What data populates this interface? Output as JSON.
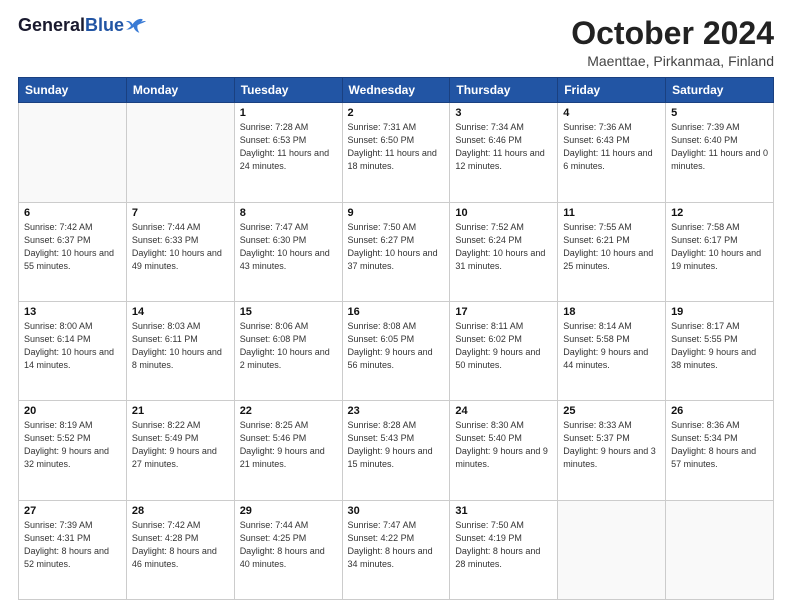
{
  "header": {
    "logo_general": "General",
    "logo_blue": "Blue",
    "month_title": "October 2024",
    "location": "Maenttae, Pirkanmaa, Finland"
  },
  "weekdays": [
    "Sunday",
    "Monday",
    "Tuesday",
    "Wednesday",
    "Thursday",
    "Friday",
    "Saturday"
  ],
  "weeks": [
    [
      {
        "day": "",
        "empty": true
      },
      {
        "day": "",
        "empty": true
      },
      {
        "day": "1",
        "sunrise": "Sunrise: 7:28 AM",
        "sunset": "Sunset: 6:53 PM",
        "daylight": "Daylight: 11 hours and 24 minutes."
      },
      {
        "day": "2",
        "sunrise": "Sunrise: 7:31 AM",
        "sunset": "Sunset: 6:50 PM",
        "daylight": "Daylight: 11 hours and 18 minutes."
      },
      {
        "day": "3",
        "sunrise": "Sunrise: 7:34 AM",
        "sunset": "Sunset: 6:46 PM",
        "daylight": "Daylight: 11 hours and 12 minutes."
      },
      {
        "day": "4",
        "sunrise": "Sunrise: 7:36 AM",
        "sunset": "Sunset: 6:43 PM",
        "daylight": "Daylight: 11 hours and 6 minutes."
      },
      {
        "day": "5",
        "sunrise": "Sunrise: 7:39 AM",
        "sunset": "Sunset: 6:40 PM",
        "daylight": "Daylight: 11 hours and 0 minutes."
      }
    ],
    [
      {
        "day": "6",
        "sunrise": "Sunrise: 7:42 AM",
        "sunset": "Sunset: 6:37 PM",
        "daylight": "Daylight: 10 hours and 55 minutes."
      },
      {
        "day": "7",
        "sunrise": "Sunrise: 7:44 AM",
        "sunset": "Sunset: 6:33 PM",
        "daylight": "Daylight: 10 hours and 49 minutes."
      },
      {
        "day": "8",
        "sunrise": "Sunrise: 7:47 AM",
        "sunset": "Sunset: 6:30 PM",
        "daylight": "Daylight: 10 hours and 43 minutes."
      },
      {
        "day": "9",
        "sunrise": "Sunrise: 7:50 AM",
        "sunset": "Sunset: 6:27 PM",
        "daylight": "Daylight: 10 hours and 37 minutes."
      },
      {
        "day": "10",
        "sunrise": "Sunrise: 7:52 AM",
        "sunset": "Sunset: 6:24 PM",
        "daylight": "Daylight: 10 hours and 31 minutes."
      },
      {
        "day": "11",
        "sunrise": "Sunrise: 7:55 AM",
        "sunset": "Sunset: 6:21 PM",
        "daylight": "Daylight: 10 hours and 25 minutes."
      },
      {
        "day": "12",
        "sunrise": "Sunrise: 7:58 AM",
        "sunset": "Sunset: 6:17 PM",
        "daylight": "Daylight: 10 hours and 19 minutes."
      }
    ],
    [
      {
        "day": "13",
        "sunrise": "Sunrise: 8:00 AM",
        "sunset": "Sunset: 6:14 PM",
        "daylight": "Daylight: 10 hours and 14 minutes."
      },
      {
        "day": "14",
        "sunrise": "Sunrise: 8:03 AM",
        "sunset": "Sunset: 6:11 PM",
        "daylight": "Daylight: 10 hours and 8 minutes."
      },
      {
        "day": "15",
        "sunrise": "Sunrise: 8:06 AM",
        "sunset": "Sunset: 6:08 PM",
        "daylight": "Daylight: 10 hours and 2 minutes."
      },
      {
        "day": "16",
        "sunrise": "Sunrise: 8:08 AM",
        "sunset": "Sunset: 6:05 PM",
        "daylight": "Daylight: 9 hours and 56 minutes."
      },
      {
        "day": "17",
        "sunrise": "Sunrise: 8:11 AM",
        "sunset": "Sunset: 6:02 PM",
        "daylight": "Daylight: 9 hours and 50 minutes."
      },
      {
        "day": "18",
        "sunrise": "Sunrise: 8:14 AM",
        "sunset": "Sunset: 5:58 PM",
        "daylight": "Daylight: 9 hours and 44 minutes."
      },
      {
        "day": "19",
        "sunrise": "Sunrise: 8:17 AM",
        "sunset": "Sunset: 5:55 PM",
        "daylight": "Daylight: 9 hours and 38 minutes."
      }
    ],
    [
      {
        "day": "20",
        "sunrise": "Sunrise: 8:19 AM",
        "sunset": "Sunset: 5:52 PM",
        "daylight": "Daylight: 9 hours and 32 minutes."
      },
      {
        "day": "21",
        "sunrise": "Sunrise: 8:22 AM",
        "sunset": "Sunset: 5:49 PM",
        "daylight": "Daylight: 9 hours and 27 minutes."
      },
      {
        "day": "22",
        "sunrise": "Sunrise: 8:25 AM",
        "sunset": "Sunset: 5:46 PM",
        "daylight": "Daylight: 9 hours and 21 minutes."
      },
      {
        "day": "23",
        "sunrise": "Sunrise: 8:28 AM",
        "sunset": "Sunset: 5:43 PM",
        "daylight": "Daylight: 9 hours and 15 minutes."
      },
      {
        "day": "24",
        "sunrise": "Sunrise: 8:30 AM",
        "sunset": "Sunset: 5:40 PM",
        "daylight": "Daylight: 9 hours and 9 minutes."
      },
      {
        "day": "25",
        "sunrise": "Sunrise: 8:33 AM",
        "sunset": "Sunset: 5:37 PM",
        "daylight": "Daylight: 9 hours and 3 minutes."
      },
      {
        "day": "26",
        "sunrise": "Sunrise: 8:36 AM",
        "sunset": "Sunset: 5:34 PM",
        "daylight": "Daylight: 8 hours and 57 minutes."
      }
    ],
    [
      {
        "day": "27",
        "sunrise": "Sunrise: 7:39 AM",
        "sunset": "Sunset: 4:31 PM",
        "daylight": "Daylight: 8 hours and 52 minutes."
      },
      {
        "day": "28",
        "sunrise": "Sunrise: 7:42 AM",
        "sunset": "Sunset: 4:28 PM",
        "daylight": "Daylight: 8 hours and 46 minutes."
      },
      {
        "day": "29",
        "sunrise": "Sunrise: 7:44 AM",
        "sunset": "Sunset: 4:25 PM",
        "daylight": "Daylight: 8 hours and 40 minutes."
      },
      {
        "day": "30",
        "sunrise": "Sunrise: 7:47 AM",
        "sunset": "Sunset: 4:22 PM",
        "daylight": "Daylight: 8 hours and 34 minutes."
      },
      {
        "day": "31",
        "sunrise": "Sunrise: 7:50 AM",
        "sunset": "Sunset: 4:19 PM",
        "daylight": "Daylight: 8 hours and 28 minutes."
      },
      {
        "day": "",
        "empty": true
      },
      {
        "day": "",
        "empty": true
      }
    ]
  ]
}
